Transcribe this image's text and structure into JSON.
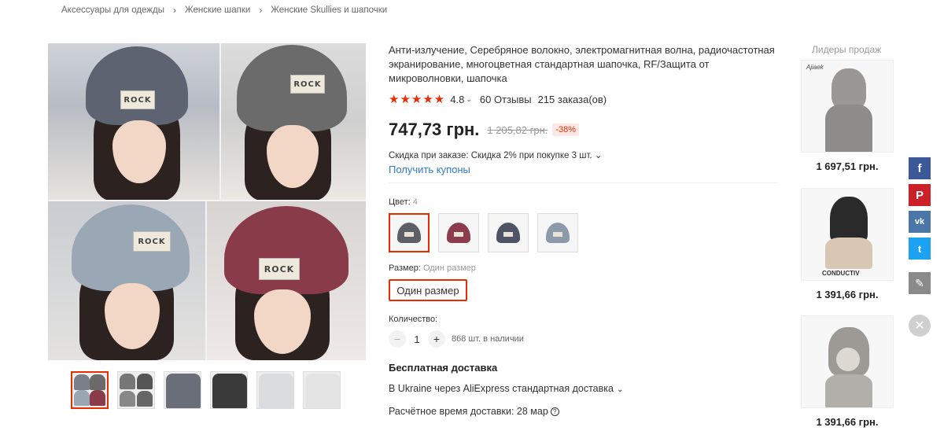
{
  "breadcrumb": [
    "Аксессуары для одежды",
    "Женские шапки",
    "Женские Skullies и шапочки"
  ],
  "gallery": {
    "patch_text": "ROCK",
    "thumb_count": 6
  },
  "product": {
    "title": "Анти-излучение, Серебряное волокно, электромагнитная волна, радиочастотная экранирование, многоцветная стандартная шапочка, RF/Защита от микроволновки, шапочка",
    "stars": "★★★★★",
    "rating": "4.8",
    "reviews": "60 Отзывы",
    "orders": "215 заказа(ов)",
    "price": "747,73 грн.",
    "old_price": "1 205,82 грн.",
    "discount": "-38%",
    "promo": "Скидка при заказе: Скидка 2% при покупке 3 шт.",
    "coupons": "Получить купоны",
    "color_label": "Цвет:",
    "color_value": "4",
    "size_label": "Размер:",
    "size_value": "Один размер",
    "size_option": "Один размер",
    "qty_label": "Количество:",
    "qty_value": "1",
    "stock": "868 шт. в наличии",
    "shipping_title": "Бесплатная доставка",
    "shipping_method": "В Ukraine через AliExpress стандартная доставка",
    "shipping_time": "Расчётное время доставки: 28 мар",
    "swatch_colors": [
      "#5c5f66",
      "#8c3c4c",
      "#4e5466",
      "#8c9aaa"
    ]
  },
  "leaders": {
    "title": "Лидеры продаж",
    "items": [
      {
        "price": "1 697,51 грн.",
        "tag": "Ajiaek",
        "brand": ""
      },
      {
        "price": "1 391,66 грн.",
        "tag": "",
        "brand": "CONDUCTIV"
      },
      {
        "price": "1 391,66 грн.",
        "tag": "",
        "brand": ""
      }
    ]
  },
  "social": {
    "fb": "f",
    "pin": "P",
    "vk": "vk",
    "tw": "t",
    "edit": "✎",
    "close": "✕"
  },
  "colors": {
    "accent": "#e62e04",
    "link": "#2e7bcf"
  }
}
